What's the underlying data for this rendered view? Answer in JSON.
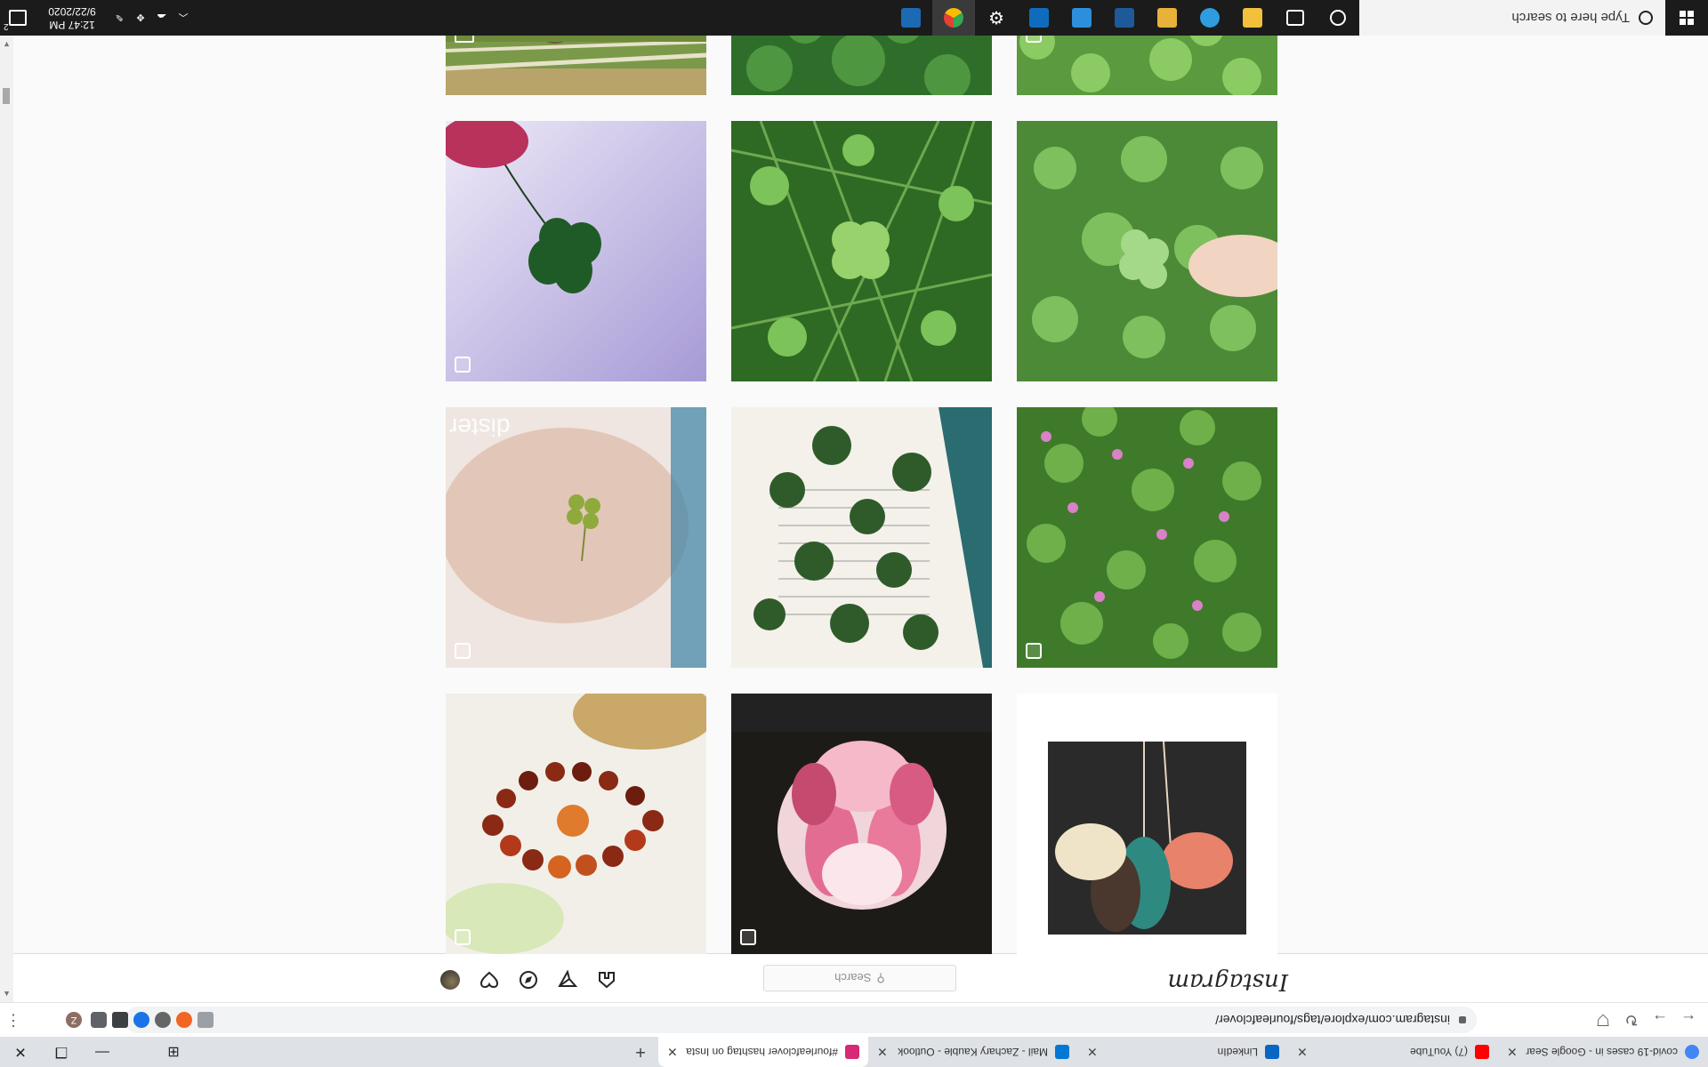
{
  "taskbar": {
    "search_placeholder": "Type here to search",
    "clock_time": "12:47 PM",
    "clock_date": "9/22/2020",
    "notification_count": "2",
    "apps": [
      {
        "name": "task-view",
        "color": "#ffffff"
      },
      {
        "name": "file-explorer",
        "color": "#f3c03b"
      },
      {
        "name": "edge",
        "color": "#2f9ce0"
      },
      {
        "name": "folder",
        "color": "#e8b13a"
      },
      {
        "name": "adobe-substance",
        "color": "#1e5a9a"
      },
      {
        "name": "photos",
        "color": "#2d8fdc"
      },
      {
        "name": "office",
        "color": "#0f6cbd"
      },
      {
        "name": "settings",
        "color": "#ffffff"
      },
      {
        "name": "chrome",
        "color": "#e44134"
      },
      {
        "name": "photo-viewer",
        "color": "#1c6ab3"
      }
    ]
  },
  "browser": {
    "tabs": [
      {
        "label": "covid-19 cases in - Google Sear",
        "favicon_color": "#4285f4"
      },
      {
        "label": "(7) YouTube",
        "favicon_color": "#ff0000"
      },
      {
        "label": "LinkedIn",
        "favicon_color": "#0a66c2"
      },
      {
        "label": "Mail - Zachary Kauble - Outlook",
        "favicon_color": "#0078d4"
      },
      {
        "label": "#fourleafclover hashtag on Insta",
        "favicon_color": "#d62976"
      }
    ],
    "new_tab": "+",
    "url": "instagram.com/explore/tags/fourleafclover/",
    "profile_initial": "Z"
  },
  "instagram": {
    "logo_text": "Instagram",
    "search_placeholder": "Search",
    "tile_overlay_text": "dister"
  }
}
